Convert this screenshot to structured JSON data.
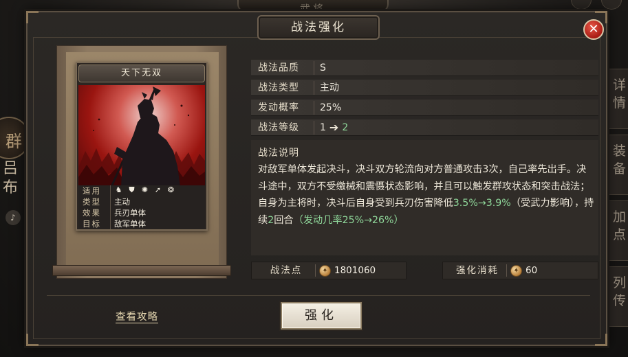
{
  "background": {
    "top_tab": "武将",
    "faction": "群",
    "general_name": "吕布",
    "sound_icon": "speaker-icon",
    "right_tabs": [
      "详情",
      "装备",
      "加点",
      "列传"
    ]
  },
  "dialog": {
    "title": "战法强化",
    "close_icon": "close-icon"
  },
  "card": {
    "name": "天下无双",
    "suit_label": "适用",
    "suit_icons": [
      "cavalry-icon",
      "shield-icon",
      "bow-icon",
      "spear-icon",
      "siege-icon"
    ],
    "stats": [
      {
        "key": "类型",
        "value": "主动"
      },
      {
        "key": "效果",
        "value": "兵刃单体"
      },
      {
        "key": "目标",
        "value": "敌军单体"
      }
    ]
  },
  "info": {
    "quality": {
      "label": "战法品质",
      "value": "S"
    },
    "type": {
      "label": "战法类型",
      "value": "主动"
    },
    "rate": {
      "label": "发动概率",
      "value": "25%"
    },
    "level": {
      "label": "战法等级",
      "from": "1",
      "to": "2"
    }
  },
  "description": {
    "title": "战法说明",
    "segments": [
      {
        "text": "对敌军单体发起决斗，决斗双方轮流向对方普通攻击3次，自己率先出手。决斗途中，双方不受缴械和震慑状态影响，并且可以触发群攻状态和突击战法；自身为主将时，决斗后自身受到兵刃伤害降低",
        "color": "#ece6d8"
      },
      {
        "text": "3.5%→3.9%",
        "color": "#8fd79a"
      },
      {
        "text": "（受武力影响），持续",
        "color": "#ece6d8"
      },
      {
        "text": "2",
        "color": "#8fd79a"
      },
      {
        "text": "回合",
        "color": "#ece6d8"
      },
      {
        "text": "（发动几率25%→26%）",
        "color": "#8fd79a"
      }
    ]
  },
  "points": {
    "label": "战法点",
    "value": "1801060"
  },
  "cost": {
    "label": "强化消耗",
    "value": "60"
  },
  "footer": {
    "guide_link": "查看攻略",
    "upgrade_button": "强化"
  },
  "colors": {
    "highlight_green": "#8fd79a",
    "close_red": "#c2281c",
    "art_red": "#9a1510"
  }
}
